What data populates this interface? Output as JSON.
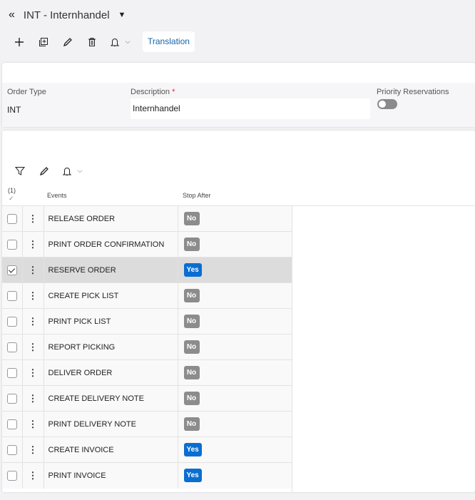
{
  "header": {
    "title": "INT - Internhandel"
  },
  "toolbar": {
    "translation_label": "Translation"
  },
  "form": {
    "order_type_label": "Order Type",
    "order_type_value": "INT",
    "description_label": "Description",
    "required_mark": "*",
    "description_value": "Internhandel",
    "priority_label": "Priority Reservations",
    "priority_on": false
  },
  "table": {
    "selected_count": "(1)",
    "check_mark": "✓",
    "headers": {
      "events": "Events",
      "stop_after": "Stop After"
    },
    "rows": [
      {
        "event": "RELEASE ORDER",
        "stop": "No",
        "checked": false
      },
      {
        "event": "PRINT ORDER CONFIRMATION",
        "stop": "No",
        "checked": false
      },
      {
        "event": "RESERVE ORDER",
        "stop": "Yes",
        "checked": true
      },
      {
        "event": "CREATE PICK LIST",
        "stop": "No",
        "checked": false
      },
      {
        "event": "PRINT PICK LIST",
        "stop": "No",
        "checked": false
      },
      {
        "event": "REPORT PICKING",
        "stop": "No",
        "checked": false
      },
      {
        "event": "DELIVER ORDER",
        "stop": "No",
        "checked": false
      },
      {
        "event": "CREATE DELIVERY NOTE",
        "stop": "No",
        "checked": false
      },
      {
        "event": "PRINT DELIVERY NOTE",
        "stop": "No",
        "checked": false
      },
      {
        "event": "CREATE INVOICE",
        "stop": "Yes",
        "checked": false
      },
      {
        "event": "PRINT INVOICE",
        "stop": "Yes",
        "checked": false
      }
    ]
  },
  "colors": {
    "accent": "#0a6ed1",
    "no_badge": "#8c8c8c"
  }
}
